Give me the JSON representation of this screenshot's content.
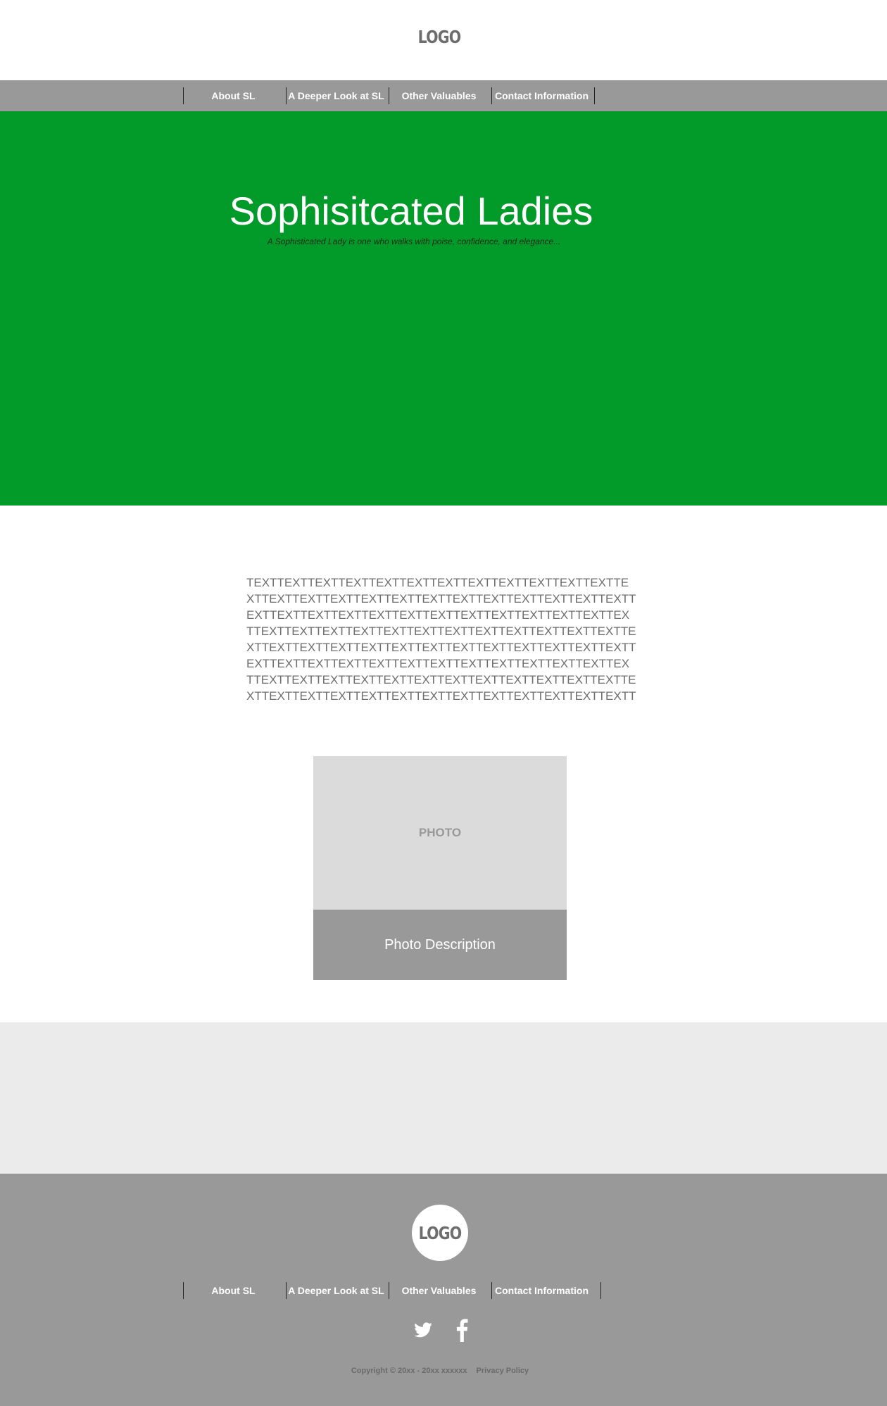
{
  "header": {
    "logo": "LOGO"
  },
  "nav": {
    "items": [
      {
        "label": "About SL"
      },
      {
        "label": "A Deeper Look at SL"
      },
      {
        "label": "Other Valuables"
      },
      {
        "label": "Contact Information"
      }
    ]
  },
  "hero": {
    "title": "Sophisitcated Ladies",
    "tagline": "A Sophisticated Lady is one who walks with poise, confidence, and elegance..."
  },
  "content": {
    "body_text": "TEXTTEXTTEXTTEXTTEXTTEXTTEXTTEXTTEXTTEXTTEXTTEXTTEXTTEXTTEXTTEXTTEXTTEXTTEXTTEXTTEXTTEXTTEXTTEXTTEXTTEXTTEXTTEXTTEXTTEXTTEXTTEXTTEXTTEXTTEXTTEXTTEXTTEXTTEXTTEXTTEXTTEXTTEXTTEXTTEXTTEXTTEXTTEXTTEXTTEXTTEXTTEXTTEXTTEXTTEXTTEXTTEXTTEXTTEXTTEXTTEXTTEXTTEXTTEXTTEXTTEXTTEXTTEXTTEXTTEXTTEXTTEXTTEXTTEXTTEXTTEXTTEXTTEXTTEXTTEXTTEXTTEXTTEXTTEXTTEXTTEXTTEXTTEXTTEXTTEXTTEXTTEXTTEXTTEXTTEXTTEXTTEXTTEXTTEXTTEXTTEXTTEXTTEXTTEXTTEXTTEXT",
    "photo_label": "PHOTO",
    "photo_description": "Photo Description"
  },
  "footer": {
    "logo": "LOGO",
    "nav": [
      {
        "label": "About SL"
      },
      {
        "label": "A Deeper Look at SL"
      },
      {
        "label": "Other Valuables"
      },
      {
        "label": "Contact Information"
      }
    ],
    "social": [
      {
        "icon": "twitter-icon"
      },
      {
        "icon": "facebook-icon"
      }
    ],
    "copyright": "Copyright © 20xx - 20xx xxxxxx",
    "privacy_label": "Privacy Policy"
  },
  "colors": {
    "hero_bg": "#029b29",
    "nav_bg": "#999999",
    "band_bg": "#ebebeb",
    "photo_bg": "#dbdbdb",
    "text_grey": "#6e6e6e"
  }
}
